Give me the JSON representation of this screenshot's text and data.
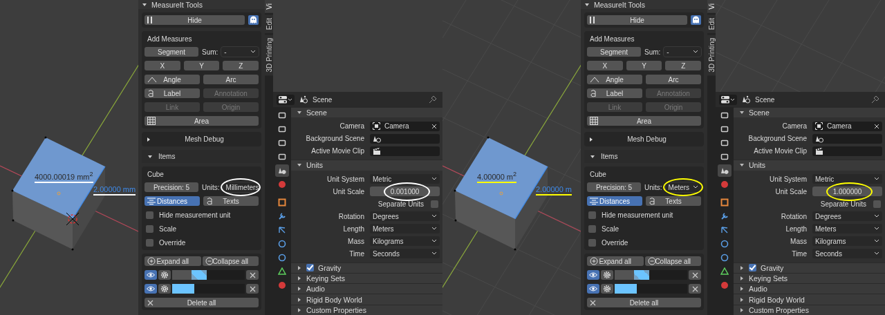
{
  "screens": [
    {
      "color": "#ffffff",
      "floor_grid": false,
      "cursor_3d": true,
      "viewport": {
        "area_label": "4000.00019 mm$^{2}$",
        "length_label": "2.00000 mm",
        "underlined": true
      },
      "sidebar_tabs": [
        {
          "label": "Vi",
          "selected": true
        },
        {
          "label": "Edit",
          "selected": false
        },
        {
          "label": "3D Printing",
          "selected": false
        }
      ],
      "measureit": {
        "title": "MeasureIt Tools",
        "hide": "Hide",
        "add_measures": {
          "title": "Add Measures",
          "segment": {
            "label": "Segment",
            "disabled": false
          },
          "sum_label": "Sum:",
          "sum_value": "-",
          "axes": [
            {
              "label": "X",
              "disabled": false
            },
            {
              "label": "Y",
              "disabled": false
            },
            {
              "label": "Z",
              "disabled": false
            }
          ],
          "angle": {
            "label": "Angle",
            "disabled": false
          },
          "arc": {
            "label": "Arc",
            "disabled": false
          },
          "label": {
            "label": "Label",
            "disabled": false
          },
          "annotation": {
            "label": "Annotation",
            "disabled": true
          },
          "link": {
            "label": "Link",
            "disabled": true
          },
          "origin": {
            "label": "Origin",
            "disabled": true
          },
          "area": {
            "label": "Area",
            "disabled": false
          }
        },
        "mesh_debug": {
          "label": "Mesh Debug",
          "expanded": false
        },
        "items": {
          "label": "Items",
          "expanded": true
        },
        "object": {
          "name": "Cube",
          "precision": "Precision:  5",
          "units_label": "Units:",
          "units": "Millimeters",
          "circled": true,
          "modes": [
            {
              "label": "Distances",
              "selected": true
            },
            {
              "label": "Texts",
              "selected": false
            }
          ],
          "options": [
            {
              "label": "Hide measurement unit",
              "checked": false
            },
            {
              "label": "Scale",
              "checked": false
            },
            {
              "label": "Override",
              "checked": false
            }
          ]
        },
        "expand_all": "Expand all",
        "collapse_all": "Collapse all",
        "measures": [
          {
            "visible": true,
            "color": "#6cc4ff",
            "transparent": true
          },
          {
            "visible": true,
            "color": "#6cc4ff",
            "transparent": false
          }
        ],
        "delete_all": "Delete all"
      },
      "properties": {
        "context": "Scene",
        "tabs": [
          {
            "selected": false
          },
          {
            "selected": false
          },
          {
            "selected": false
          },
          {
            "selected": false
          },
          {
            "selected": true
          },
          {
            "selected": false
          },
          {
            "selected": false
          },
          {
            "selected": false
          },
          {
            "selected": false
          },
          {
            "selected": false
          },
          {
            "selected": false
          },
          {
            "selected": false
          },
          {
            "selected": false
          }
        ],
        "sections": [
          {
            "title": "Scene",
            "expanded": true,
            "rows": [
              {
                "kind": "object",
                "label": "Camera",
                "value": "Camera"
              },
              {
                "kind": "scene",
                "label": "Background Scene"
              },
              {
                "kind": "clip",
                "label": "Active Movie Clip"
              }
            ]
          },
          {
            "title": "Units",
            "expanded": true,
            "rows": [
              {
                "kind": "dropdown",
                "label": "Unit System",
                "value": "Metric"
              },
              {
                "kind": "number",
                "label": "Unit Scale",
                "value": "0.001000",
                "circled": true
              },
              {
                "kind": "checkbox",
                "label": "Separate Units",
                "checked": false
              },
              {
                "kind": "dropdown",
                "label": "Rotation",
                "value": "Degrees"
              },
              {
                "kind": "dropdown",
                "label": "Length",
                "value": "Meters"
              },
              {
                "kind": "dropdown",
                "label": "Mass",
                "value": "Kilograms"
              },
              {
                "kind": "dropdown",
                "label": "Time",
                "value": "Seconds"
              }
            ]
          },
          {
            "title": "Gravity",
            "expanded": false,
            "checked": true
          },
          {
            "title": "Keying Sets",
            "expanded": false
          },
          {
            "title": "Audio",
            "expanded": false
          },
          {
            "title": "Rigid Body World",
            "expanded": false
          },
          {
            "title": "Custom Properties",
            "expanded": false
          }
        ]
      }
    },
    {
      "color": "#ffff00",
      "floor_grid": true,
      "cursor_3d": false,
      "viewport": {
        "area_label": "4.00000 m$^{2}$",
        "length_label": "2.00000 m",
        "underlined": true
      },
      "sidebar_tabs": [
        {
          "label": "Vi",
          "selected": true
        },
        {
          "label": "Edit",
          "selected": false
        },
        {
          "label": "3D Printing",
          "selected": false
        }
      ],
      "measureit": {
        "title": "MeasureIt Tools",
        "hide": "Hide",
        "add_measures": {
          "title": "Add Measures",
          "segment": {
            "label": "Segment",
            "disabled": false
          },
          "sum_label": "Sum:",
          "sum_value": "-",
          "axes": [
            {
              "label": "X",
              "disabled": false
            },
            {
              "label": "Y",
              "disabled": false
            },
            {
              "label": "Z",
              "disabled": false
            }
          ],
          "angle": {
            "label": "Angle",
            "disabled": false
          },
          "arc": {
            "label": "Arc",
            "disabled": false
          },
          "label": {
            "label": "Label",
            "disabled": false
          },
          "annotation": {
            "label": "Annotation",
            "disabled": true
          },
          "link": {
            "label": "Link",
            "disabled": true
          },
          "origin": {
            "label": "Origin",
            "disabled": true
          },
          "area": {
            "label": "Area",
            "disabled": false
          }
        },
        "mesh_debug": {
          "label": "Mesh Debug",
          "expanded": false
        },
        "items": {
          "label": "Items",
          "expanded": true
        },
        "object": {
          "name": "Cube",
          "precision": "Precision:  5",
          "units_label": "Units:",
          "units": "Meters",
          "circled": true,
          "modes": [
            {
              "label": "Distances",
              "selected": true
            },
            {
              "label": "Texts",
              "selected": false
            }
          ],
          "options": [
            {
              "label": "Hide measurement unit",
              "checked": false
            },
            {
              "label": "Scale",
              "checked": false
            },
            {
              "label": "Override",
              "checked": false
            }
          ]
        },
        "expand_all": "Expand all",
        "collapse_all": "Collapse all",
        "measures": [
          {
            "visible": true,
            "color": "#6cc4ff",
            "transparent": true
          },
          {
            "visible": true,
            "color": "#6cc4ff",
            "transparent": false
          }
        ],
        "delete_all": "Delete all"
      },
      "properties": {
        "context": "Scene",
        "tabs": [
          {
            "selected": false
          },
          {
            "selected": false
          },
          {
            "selected": false
          },
          {
            "selected": false
          },
          {
            "selected": true
          },
          {
            "selected": false
          },
          {
            "selected": false
          },
          {
            "selected": false
          },
          {
            "selected": false
          },
          {
            "selected": false
          },
          {
            "selected": false
          },
          {
            "selected": false
          },
          {
            "selected": false
          }
        ],
        "sections": [
          {
            "title": "Scene",
            "expanded": true,
            "rows": [
              {
                "kind": "object",
                "label": "Camera",
                "value": "Camera"
              },
              {
                "kind": "scene",
                "label": "Background Scene"
              },
              {
                "kind": "clip",
                "label": "Active Movie Clip"
              }
            ]
          },
          {
            "title": "Units",
            "expanded": true,
            "rows": [
              {
                "kind": "dropdown",
                "label": "Unit System",
                "value": "Metric"
              },
              {
                "kind": "number",
                "label": "Unit Scale",
                "value": "1.000000",
                "circled": true
              },
              {
                "kind": "checkbox",
                "label": "Separate Units",
                "checked": false
              },
              {
                "kind": "dropdown",
                "label": "Rotation",
                "value": "Degrees"
              },
              {
                "kind": "dropdown",
                "label": "Length",
                "value": "Meters"
              },
              {
                "kind": "dropdown",
                "label": "Mass",
                "value": "Kilograms"
              },
              {
                "kind": "dropdown",
                "label": "Time",
                "value": "Seconds"
              }
            ]
          },
          {
            "title": "Gravity",
            "expanded": false,
            "checked": true
          },
          {
            "title": "Keying Sets",
            "expanded": false
          },
          {
            "title": "Audio",
            "expanded": false
          },
          {
            "title": "Rigid Body World",
            "expanded": false
          },
          {
            "title": "Custom Properties",
            "expanded": false
          }
        ]
      }
    }
  ]
}
